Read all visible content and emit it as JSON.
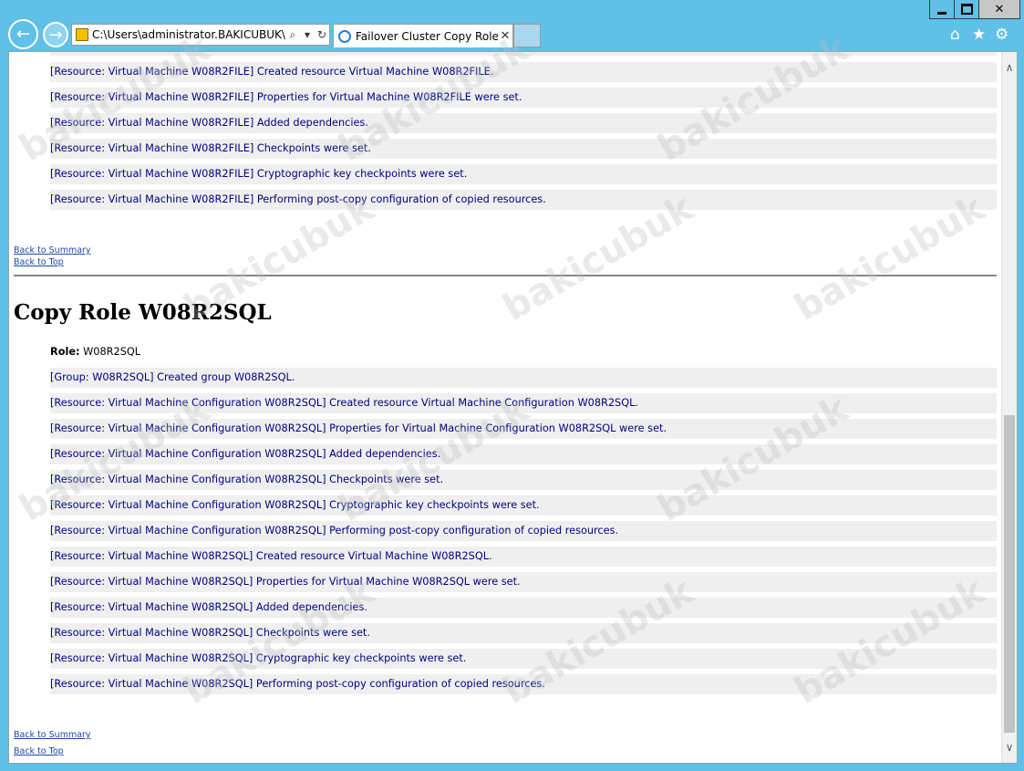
{
  "browser": {
    "address_url": "C:\\Users\\administrator.BAKICUBUK\\Ap",
    "tab_title": "Failover Cluster Copy Roles ..."
  },
  "top_section": {
    "rows": [
      "[Resource: Virtual Machine W08R2FILE] Created resource Virtual Machine W08R2FILE.",
      "[Resource: Virtual Machine W08R2FILE] Properties for Virtual Machine W08R2FILE were set.",
      "[Resource: Virtual Machine W08R2FILE] Added dependencies.",
      "[Resource: Virtual Machine W08R2FILE] Checkpoints were set.",
      "[Resource: Virtual Machine W08R2FILE] Cryptographic key checkpoints were set.",
      "[Resource: Virtual Machine W08R2FILE] Performing post-copy configuration of copied resources."
    ],
    "back_to_summary": "Back to Summary",
    "back_to_top": "Back to Top"
  },
  "section": {
    "heading": "Copy Role W08R2SQL",
    "role_label": "Role:",
    "role_value": "W08R2SQL",
    "rows": [
      "[Group: W08R2SQL] Created group W08R2SQL.",
      "[Resource: Virtual Machine Configuration W08R2SQL] Created resource Virtual Machine Configuration W08R2SQL.",
      "[Resource: Virtual Machine Configuration W08R2SQL] Properties for Virtual Machine Configuration W08R2SQL were set.",
      "[Resource: Virtual Machine Configuration W08R2SQL] Added dependencies.",
      "[Resource: Virtual Machine Configuration W08R2SQL] Checkpoints were set.",
      "[Resource: Virtual Machine Configuration W08R2SQL] Cryptographic key checkpoints were set.",
      "[Resource: Virtual Machine Configuration W08R2SQL] Performing post-copy configuration of copied resources.",
      "[Resource: Virtual Machine W08R2SQL] Created resource Virtual Machine W08R2SQL.",
      "[Resource: Virtual Machine W08R2SQL] Properties for Virtual Machine W08R2SQL were set.",
      "[Resource: Virtual Machine W08R2SQL] Added dependencies.",
      "[Resource: Virtual Machine W08R2SQL] Checkpoints were set.",
      "[Resource: Virtual Machine W08R2SQL] Cryptographic key checkpoints were set.",
      "[Resource: Virtual Machine W08R2SQL] Performing post-copy configuration of copied resources."
    ],
    "back_to_summary": "Back to Summary",
    "back_to_top": "Back to Top"
  },
  "watermark": "bakicubuk"
}
